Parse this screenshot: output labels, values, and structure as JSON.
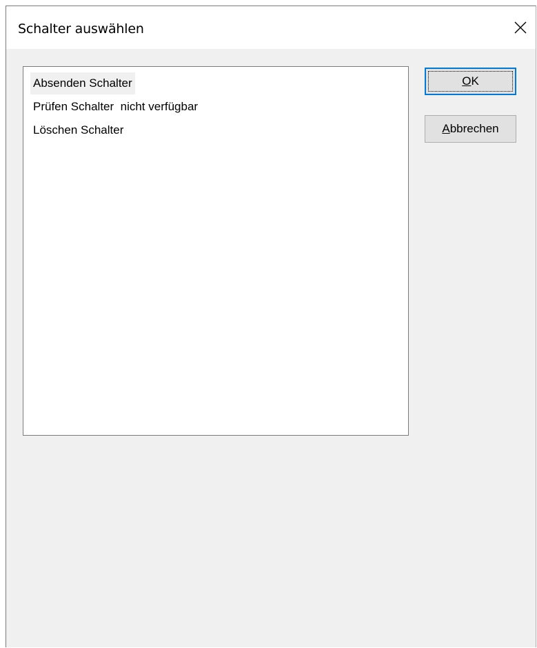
{
  "window": {
    "title": "Schalter auswählen",
    "close_glyph": "✕"
  },
  "list": {
    "items": [
      {
        "label": "Absenden Schalter",
        "selected": true
      },
      {
        "label": "Prüfen Schalter  nicht verfügbar",
        "selected": false
      },
      {
        "label": "Löschen Schalter",
        "selected": false
      }
    ]
  },
  "buttons": {
    "ok": {
      "mnemonic": "O",
      "rest": "K"
    },
    "cancel": {
      "mnemonic": "A",
      "rest": "bbrechen"
    }
  },
  "colors": {
    "default_button_border": "#0078d7",
    "button_face": "#e1e1e1",
    "dialog_background": "#f0f0f0"
  }
}
